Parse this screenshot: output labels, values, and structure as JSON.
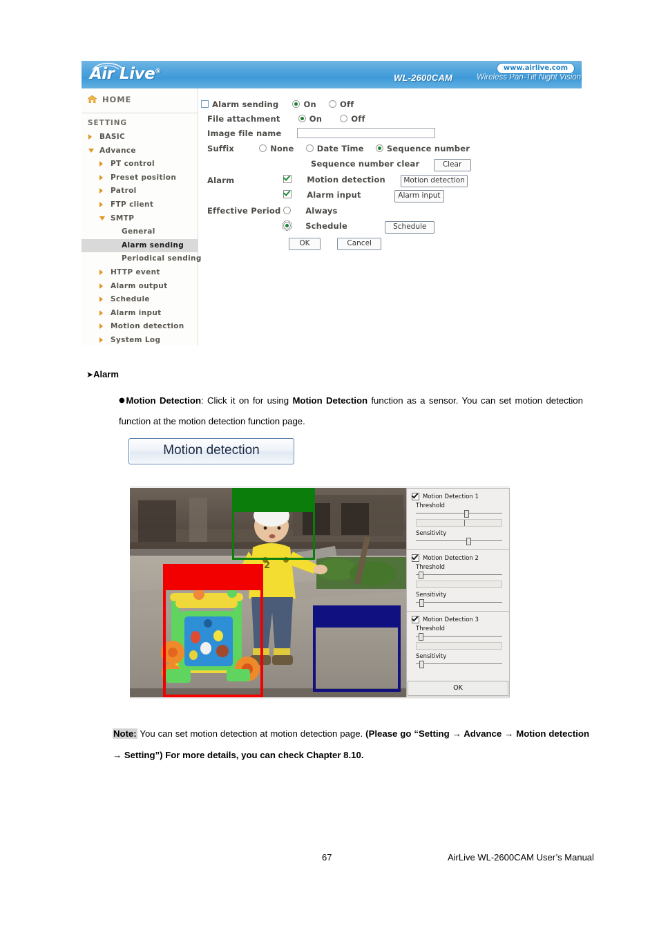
{
  "camera_ui": {
    "header": {
      "brand": "Air Live",
      "model": "WL-2600CAM",
      "tagline": "Wireless Pan-Tilt Night Vision IP Camera",
      "url": "www.airlive.com"
    },
    "sidebar": {
      "home_label": "HOME",
      "setting_label": "SETTING",
      "items": [
        {
          "label": "BASIC",
          "level": 0,
          "state": "collapsed",
          "selected": false
        },
        {
          "label": "Advance",
          "level": 0,
          "state": "expanded",
          "selected": false
        },
        {
          "label": "PT control",
          "level": 1,
          "state": "collapsed",
          "selected": false
        },
        {
          "label": "Preset position",
          "level": 1,
          "state": "collapsed",
          "selected": false
        },
        {
          "label": "Patrol",
          "level": 1,
          "state": "collapsed",
          "selected": false
        },
        {
          "label": "FTP client",
          "level": 1,
          "state": "collapsed",
          "selected": false
        },
        {
          "label": "SMTP",
          "level": 1,
          "state": "expanded",
          "selected": false
        },
        {
          "label": "General",
          "level": 2,
          "state": "leaf",
          "selected": false
        },
        {
          "label": "Alarm sending",
          "level": 2,
          "state": "leaf",
          "selected": true
        },
        {
          "label": "Periodical sending",
          "level": 2,
          "state": "leaf",
          "selected": false
        },
        {
          "label": "HTTP event",
          "level": 1,
          "state": "collapsed",
          "selected": false
        },
        {
          "label": "Alarm output",
          "level": 1,
          "state": "collapsed",
          "selected": false
        },
        {
          "label": "Schedule",
          "level": 1,
          "state": "collapsed",
          "selected": false
        },
        {
          "label": "Alarm input",
          "level": 1,
          "state": "collapsed",
          "selected": false
        },
        {
          "label": "Motion detection",
          "level": 1,
          "state": "collapsed",
          "selected": false
        },
        {
          "label": "System Log",
          "level": 1,
          "state": "collapsed",
          "selected": false
        }
      ]
    },
    "form": {
      "alarm_sending_label": "Alarm sending",
      "alarm_sending_on": "On",
      "alarm_sending_off": "Off",
      "alarm_sending_value": "On",
      "file_attachment_label": "File attachment",
      "file_attachment_on": "On",
      "file_attachment_off": "Off",
      "file_attachment_value": "On",
      "image_file_name_label": "Image file name",
      "image_file_name_value": "",
      "suffix_label": "Suffix",
      "suffix_none": "None",
      "suffix_date_time": "Date Time",
      "suffix_sequence_number": "Sequence number",
      "suffix_value": "Sequence number",
      "sequence_number_clear_label": "Sequence number clear",
      "clear_button": "Clear",
      "alarm_label": "Alarm",
      "motion_detection_checkbox": "Motion detection",
      "motion_detection_checked": true,
      "motion_detection_button": "Motion detection",
      "alarm_input_checkbox": "Alarm input",
      "alarm_input_checked": true,
      "alarm_input_button": "Alarm input",
      "effective_period_label": "Effective Period",
      "always_label": "Always",
      "schedule_label": "Schedule",
      "effective_period_value": "Schedule",
      "schedule_button": "Schedule",
      "ok_button": "OK",
      "cancel_button": "Cancel"
    }
  },
  "doc": {
    "section_heading": "Alarm",
    "section_arrow": "➤",
    "bullet": "●",
    "paragraph_parts": {
      "b1": "Motion Detection",
      "t1": ": Click it on for using ",
      "b2": "Motion Detection",
      "t2": " function as a sensor. You can set motion detection function at the motion detection function page."
    },
    "motion_detection_button_image": "Motion detection",
    "note": {
      "tag": "Note:",
      "t1": " You can set motion detection at motion detection page. ",
      "b1": "(Please go “Setting → Advance → Motion detection → Setting”) For more details, you can check Chapter 8.10."
    }
  },
  "motion_detection_window": {
    "zones": [
      {
        "name": "zone-1",
        "color": "#0a7d0a",
        "label": "green"
      },
      {
        "name": "zone-2",
        "color": "#f20000",
        "label": "red"
      },
      {
        "name": "zone-3",
        "color": "#101080",
        "label": "blue"
      }
    ],
    "sections": [
      {
        "title": "Motion Detection 1",
        "checked": true,
        "threshold_label": "Threshold",
        "threshold_pct": 56,
        "meter_mark_pct": 56,
        "sensitivity_label": "Sensitivity",
        "sensitivity_pct": 58
      },
      {
        "title": "Motion Detection 2",
        "checked": true,
        "threshold_label": "Threshold",
        "threshold_pct": 3,
        "meter_mark_pct": 0,
        "sensitivity_label": "Sensitivity",
        "sensitivity_pct": 4
      },
      {
        "title": "Motion Detection 3",
        "checked": true,
        "threshold_label": "Threshold",
        "threshold_pct": 3,
        "meter_mark_pct": 0,
        "sensitivity_label": "Sensitivity",
        "sensitivity_pct": 4
      }
    ],
    "ok_button": "OK"
  },
  "footer": {
    "page_number": "67",
    "manual_title": "AirLive WL-2600CAM User’s Manual"
  }
}
